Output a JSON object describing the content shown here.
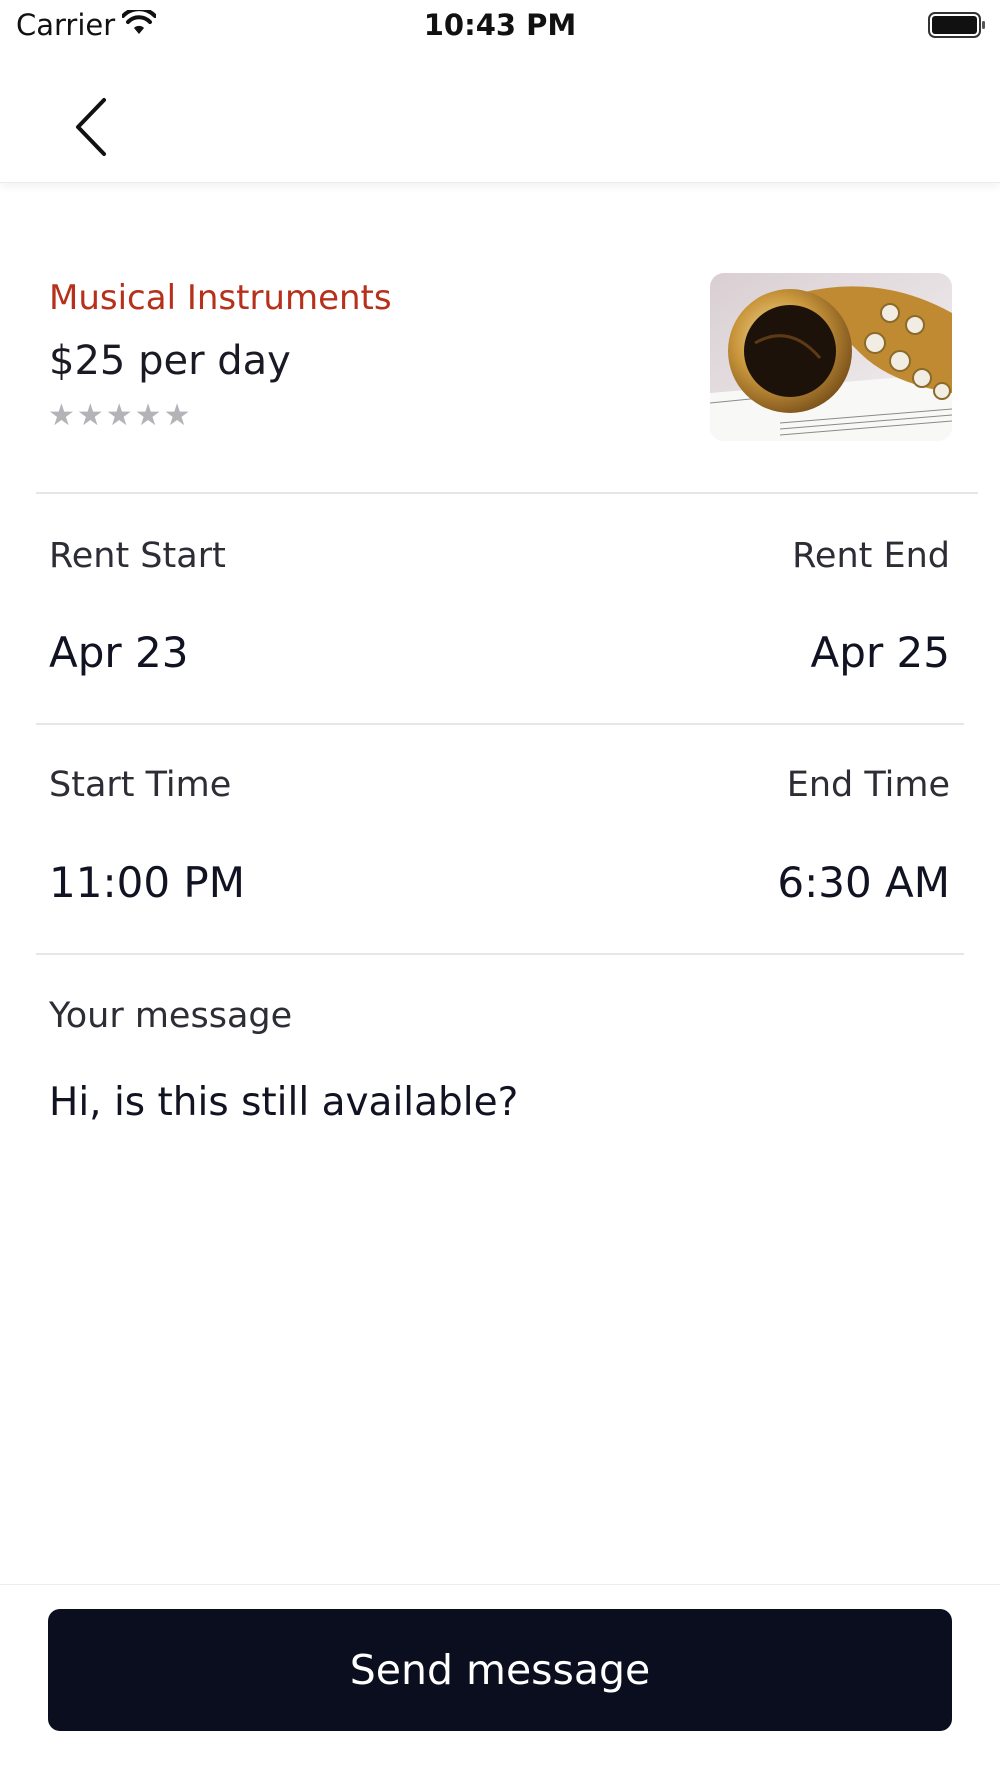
{
  "status_bar": {
    "carrier": "Carrier",
    "time": "10:43 PM"
  },
  "listing": {
    "category": "Musical Instruments",
    "price": "$25 per day",
    "rating": {
      "stars_text": "★★★★★",
      "filled": 0,
      "max": 5
    },
    "image_icon": "saxophone-photo"
  },
  "rental": {
    "start_label": "Rent Start",
    "end_label": "Rent End",
    "start_date": "Apr 23",
    "end_date": "Apr 25",
    "start_time_label": "Start Time",
    "end_time_label": "End Time",
    "start_time": "11:00 PM",
    "end_time": "6:30 AM"
  },
  "message": {
    "label": "Your message",
    "value": "Hi, is this still available?"
  },
  "footer": {
    "send_label": "Send message"
  },
  "colors": {
    "accent": "#b7301a",
    "button": "#0b0e1e",
    "stars": "#b3b3b8"
  }
}
